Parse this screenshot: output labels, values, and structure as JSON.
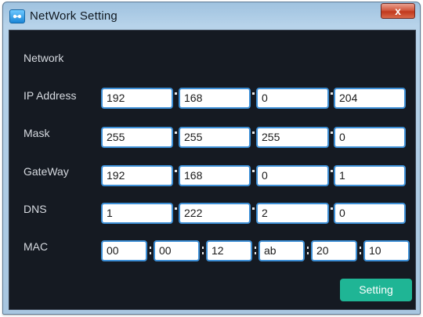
{
  "window": {
    "title": "NetWork Setting",
    "close_label": "x"
  },
  "section": {
    "title": "Network"
  },
  "rows": {
    "ip": {
      "label": "IP Address",
      "values": [
        "192",
        "168",
        "0",
        "204"
      ]
    },
    "mask": {
      "label": "Mask",
      "values": [
        "255",
        "255",
        "255",
        "0"
      ]
    },
    "gateway": {
      "label": "GateWay",
      "values": [
        "192",
        "168",
        "0",
        "1"
      ]
    },
    "dns": {
      "label": "DNS",
      "values": [
        "1",
        "222",
        "2",
        "0"
      ]
    },
    "mac": {
      "label": "MAC",
      "values": [
        "00",
        "00",
        "12",
        "ab",
        "20",
        "10"
      ]
    }
  },
  "actions": {
    "setting_label": "Setting"
  },
  "colors": {
    "panel_bg": "#151a22",
    "field_border": "#3d8fd6",
    "button_accent": "#1fb595",
    "close_red": "#c1381d"
  },
  "icons": {
    "app": "network-app-icon",
    "close": "close-icon"
  }
}
